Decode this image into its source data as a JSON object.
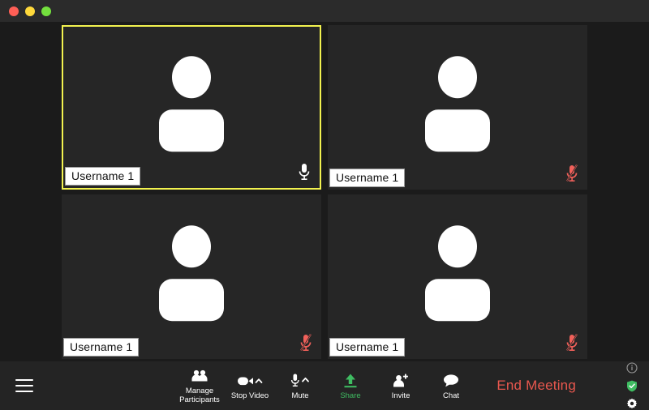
{
  "window": {
    "traffic_lights": [
      {
        "name": "close",
        "color": "#ff5f56"
      },
      {
        "name": "minimize",
        "color": "#ffd93b"
      },
      {
        "name": "zoom",
        "color": "#74e03e"
      }
    ]
  },
  "colors": {
    "active_border": "#f2f24f",
    "muted_mic": "#f0605a",
    "share_green": "#3fbd62",
    "end_meeting_red": "#e8574e",
    "shield_green": "#3fbd62",
    "tile_bg": "#262626",
    "stage_bg": "#1b1b1b",
    "toolbar_bg": "#242424"
  },
  "stage": {
    "tiles": [
      {
        "name": "Username 1",
        "muted": false,
        "active": true,
        "mic_icon": "microphone-icon"
      },
      {
        "name": "Username 1",
        "muted": true,
        "active": false,
        "mic_icon": "microphone-muted-icon"
      },
      {
        "name": "Username 1",
        "muted": true,
        "active": false,
        "mic_icon": "microphone-muted-icon"
      },
      {
        "name": "Username 1",
        "muted": true,
        "active": false,
        "mic_icon": "microphone-muted-icon"
      }
    ]
  },
  "toolbar": {
    "menu_icon": "hamburger-menu-icon",
    "tools": [
      {
        "id": "manage-participants",
        "label": "Manage\nParticipants",
        "icon": "participants-icon",
        "caret": false,
        "accent": false
      },
      {
        "id": "stop-video",
        "label": "Stop Video",
        "icon": "video-camera-icon",
        "caret": true,
        "accent": false
      },
      {
        "id": "mute",
        "label": "Mute",
        "icon": "microphone-icon",
        "caret": true,
        "accent": false
      },
      {
        "id": "share",
        "label": "Share",
        "icon": "share-upload-icon",
        "caret": false,
        "accent": true
      },
      {
        "id": "invite",
        "label": "Invite",
        "icon": "add-person-icon",
        "caret": false,
        "accent": false
      },
      {
        "id": "chat",
        "label": "Chat",
        "icon": "chat-bubble-icon",
        "caret": false,
        "accent": false
      }
    ],
    "end_meeting_label": "End Meeting",
    "right_icons": [
      {
        "id": "info",
        "icon": "info-circle-icon"
      },
      {
        "id": "security",
        "icon": "shield-check-icon"
      },
      {
        "id": "settings",
        "icon": "gear-icon"
      }
    ]
  }
}
